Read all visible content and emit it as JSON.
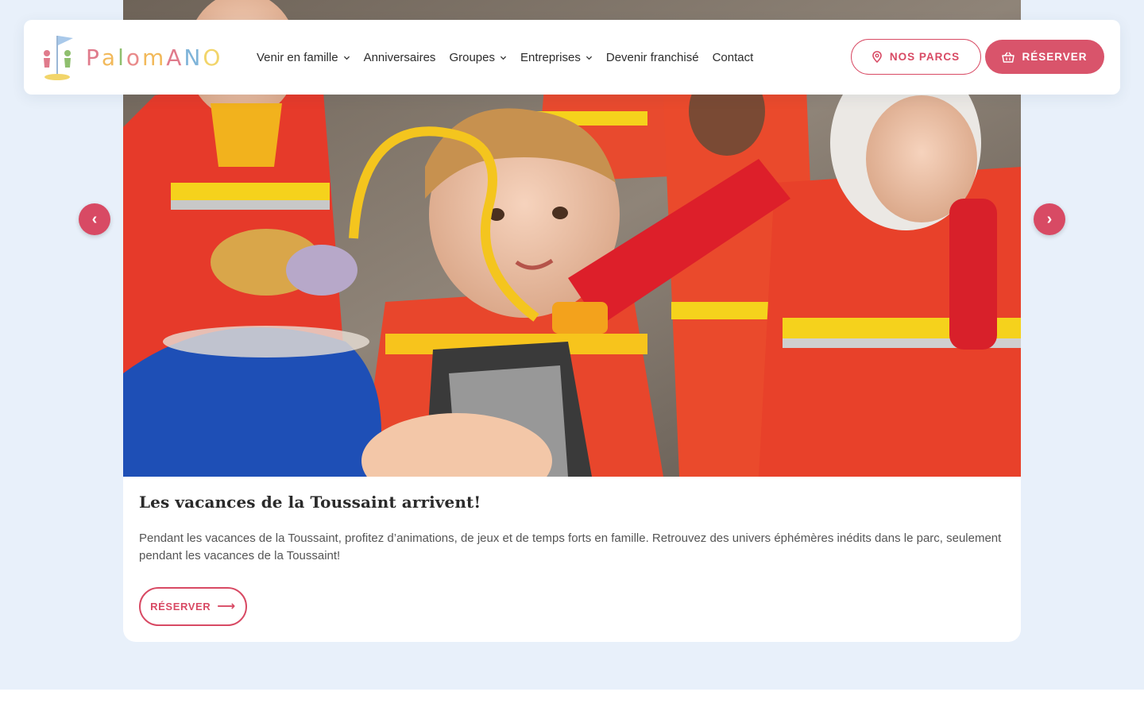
{
  "brand": {
    "logo_letters": [
      "P",
      "a",
      "l",
      "o",
      "m",
      "A",
      "N",
      "O"
    ],
    "logo_colors": [
      "#e07b8c",
      "#f2b95a",
      "#8fbf6e",
      "#e98a8a",
      "#f2b95a",
      "#e07b8c",
      "#7fb4d9",
      "#f2d56a"
    ],
    "accent": "#d84a64",
    "background": "#e8f0fa"
  },
  "nav": {
    "items": [
      {
        "label": "Venir en famille",
        "has_dropdown": true
      },
      {
        "label": "Anniversaires",
        "has_dropdown": false
      },
      {
        "label": "Groupes",
        "has_dropdown": true
      },
      {
        "label": "Entreprises",
        "has_dropdown": true
      },
      {
        "label": "Devenir franchisé",
        "has_dropdown": false
      },
      {
        "label": "Contact",
        "has_dropdown": false
      }
    ],
    "parcs_label": "NOS PARCS",
    "parcs_icon": "map-pin-icon",
    "reserver_label": "RÉSERVER",
    "reserver_icon": "basket-icon"
  },
  "slider": {
    "prev_label": "‹",
    "next_label": "›"
  },
  "slide": {
    "title": "Les vacances de la Toussaint arrivent!",
    "text": "Pendant les vacances de la Toussaint, profitez d’animations, de jeux et de temps forts en famille. Retrouvez des univers éphémères inédits dans le parc, seulement pendant les vacances de la Toussaint!",
    "cta_label": "RÉSERVER",
    "cta_arrow": "⟶"
  }
}
